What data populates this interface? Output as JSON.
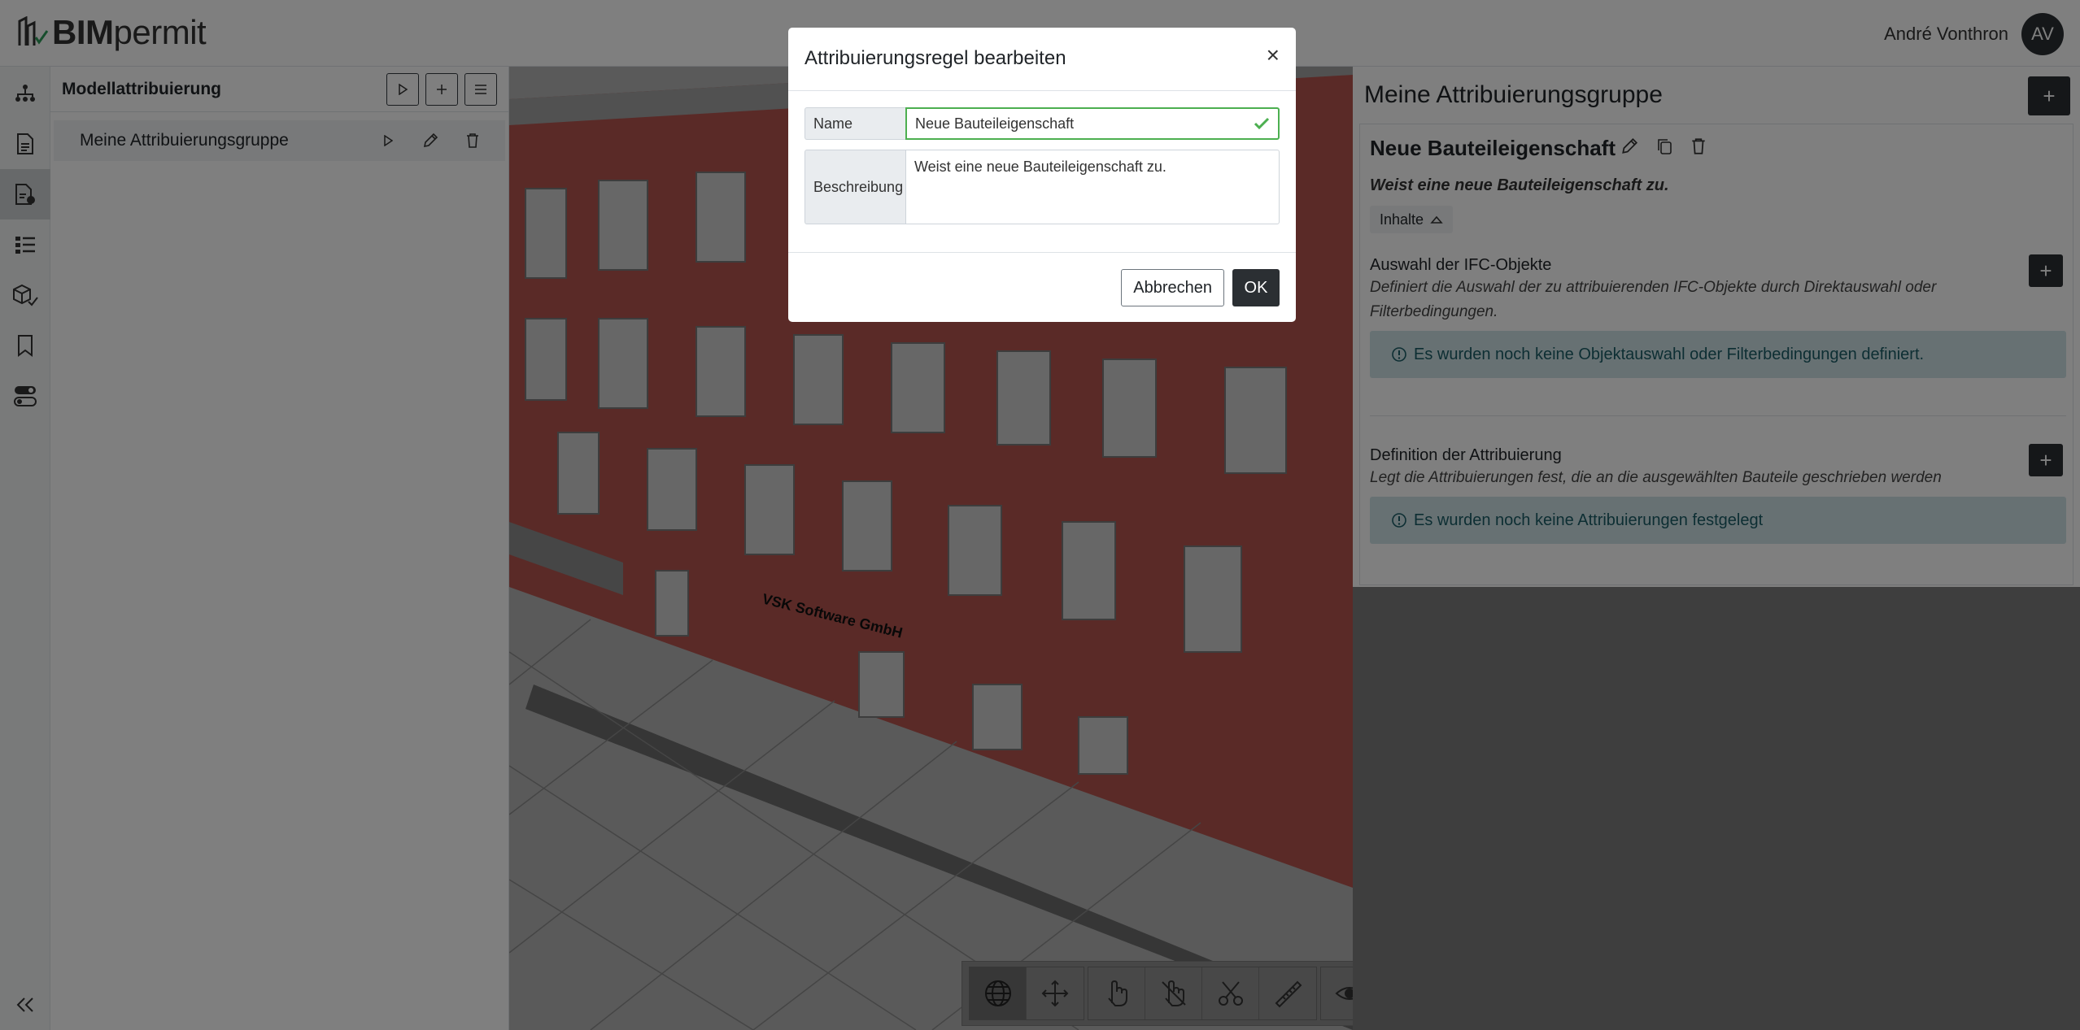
{
  "header": {
    "logo_bold": "BIM",
    "logo_light": "permit",
    "user_name": "André Vonthron",
    "user_initials": "AV"
  },
  "left_panel": {
    "title": "Modellattribuierung",
    "group_name": "Meine Attribuierungsgruppe"
  },
  "viewport": {
    "facade_sign": "VSK Software GmbH"
  },
  "right_panel": {
    "title": "Meine Attribuierungsgruppe",
    "rule_title": "Neue Bauteileigenschaft",
    "rule_description": "Weist eine neue Bauteileigenschaft zu.",
    "contents_label": "Inhalte",
    "sections": [
      {
        "title": "Auswahl der IFC-Objekte",
        "description": "Definiert die Auswahl der zu attribuierenden IFC-Objekte durch Direktauswahl oder Filterbedingungen.",
        "info": "Es wurden noch keine Objektauswahl oder Filterbedingungen definiert."
      },
      {
        "title": "Definition der Attribuierung",
        "description": "Legt die Attribuierungen fest, die an die ausgewählten Bauteile geschrieben werden",
        "info": "Es wurden noch keine Attribuierungen festgelegt"
      }
    ]
  },
  "modal": {
    "title": "Attribuierungsregel bearbeiten",
    "name_label": "Name",
    "name_value": "Neue Bauteileigenschaft",
    "description_label": "Beschreibung",
    "description_value": "Weist eine neue Bauteileigenschaft zu.",
    "cancel_label": "Abbrechen",
    "ok_label": "OK"
  },
  "colors": {
    "dark": "#2b2f33",
    "valid": "#4caf50",
    "info_bg": "#cfe3e6",
    "facade": "#b5544f"
  }
}
